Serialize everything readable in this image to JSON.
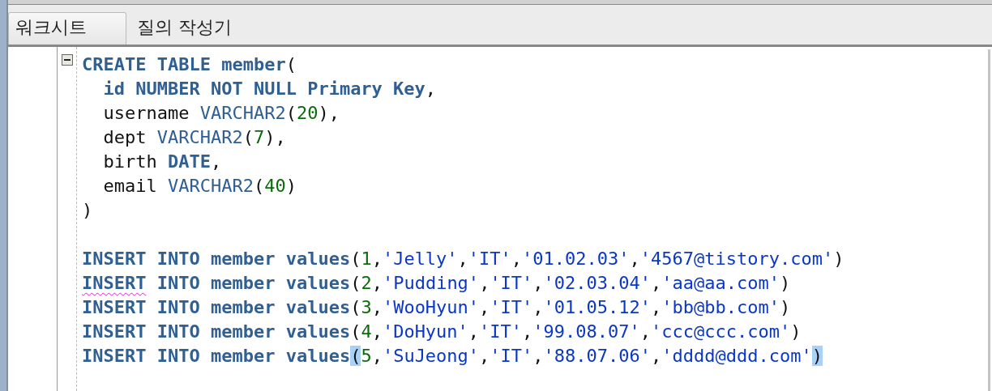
{
  "tabs": [
    {
      "label": "워크시트",
      "selected": true
    },
    {
      "label": "질의 작성기",
      "selected": false
    }
  ],
  "editor": {
    "lines": [
      {
        "kind": "code",
        "expanded": true,
        "tokens": [
          {
            "kind": "keyword",
            "text": "CREATE TABLE member"
          },
          {
            "kind": "plain",
            "text": "("
          }
        ]
      },
      {
        "kind": "code",
        "tokens": [
          {
            "kind": "keyword",
            "text": "  id NUMBER NOT NULL Primary Key"
          },
          {
            "kind": "plain",
            "text": ","
          }
        ]
      },
      {
        "kind": "code",
        "tokens": [
          {
            "kind": "plain",
            "text": "  username "
          },
          {
            "kind": "type",
            "text": "VARCHAR2"
          },
          {
            "kind": "plain",
            "text": "("
          },
          {
            "kind": "number",
            "text": "20"
          },
          {
            "kind": "plain",
            "text": "),"
          }
        ]
      },
      {
        "kind": "code",
        "tokens": [
          {
            "kind": "plain",
            "text": "  dept "
          },
          {
            "kind": "type",
            "text": "VARCHAR2"
          },
          {
            "kind": "plain",
            "text": "("
          },
          {
            "kind": "number",
            "text": "7"
          },
          {
            "kind": "plain",
            "text": "),"
          }
        ]
      },
      {
        "kind": "code",
        "tokens": [
          {
            "kind": "plain",
            "text": "  birth "
          },
          {
            "kind": "keyword",
            "text": "DATE"
          },
          {
            "kind": "plain",
            "text": ","
          }
        ]
      },
      {
        "kind": "code",
        "tokens": [
          {
            "kind": "plain",
            "text": "  email "
          },
          {
            "kind": "type",
            "text": "VARCHAR2"
          },
          {
            "kind": "plain",
            "text": "("
          },
          {
            "kind": "number",
            "text": "40"
          },
          {
            "kind": "plain",
            "text": ")"
          }
        ]
      },
      {
        "kind": "code",
        "tokens": [
          {
            "kind": "plain",
            "text": ")"
          }
        ]
      },
      {
        "kind": "blank"
      },
      {
        "kind": "code",
        "tokens": [
          {
            "kind": "keyword",
            "text": "INSERT INTO member values"
          },
          {
            "kind": "plain",
            "text": "("
          },
          {
            "kind": "number",
            "text": "1"
          },
          {
            "kind": "plain",
            "text": ","
          },
          {
            "kind": "string",
            "text": "'Jelly'"
          },
          {
            "kind": "plain",
            "text": ","
          },
          {
            "kind": "string",
            "text": "'IT'"
          },
          {
            "kind": "plain",
            "text": ","
          },
          {
            "kind": "string",
            "text": "'01.02.03'"
          },
          {
            "kind": "plain",
            "text": ","
          },
          {
            "kind": "string",
            "text": "'4567@tistory.com'"
          },
          {
            "kind": "plain",
            "text": ")"
          }
        ]
      },
      {
        "kind": "code",
        "tokens": [
          {
            "kind": "keyword",
            "text": "INSERT",
            "misspelled": true
          },
          {
            "kind": "keyword",
            "text": " INTO member values"
          },
          {
            "kind": "plain",
            "text": "("
          },
          {
            "kind": "number",
            "text": "2"
          },
          {
            "kind": "plain",
            "text": ","
          },
          {
            "kind": "string",
            "text": "'Pudding'"
          },
          {
            "kind": "plain",
            "text": ","
          },
          {
            "kind": "string",
            "text": "'IT'"
          },
          {
            "kind": "plain",
            "text": ","
          },
          {
            "kind": "string",
            "text": "'02.03.04'"
          },
          {
            "kind": "plain",
            "text": ","
          },
          {
            "kind": "string",
            "text": "'aa@aa.com'"
          },
          {
            "kind": "plain",
            "text": ")"
          }
        ]
      },
      {
        "kind": "code",
        "tokens": [
          {
            "kind": "keyword",
            "text": "INSERT INTO member values"
          },
          {
            "kind": "plain",
            "text": "("
          },
          {
            "kind": "number",
            "text": "3"
          },
          {
            "kind": "plain",
            "text": ","
          },
          {
            "kind": "string",
            "text": "'WooHyun'"
          },
          {
            "kind": "plain",
            "text": ","
          },
          {
            "kind": "string",
            "text": "'IT'"
          },
          {
            "kind": "plain",
            "text": ","
          },
          {
            "kind": "string",
            "text": "'01.05.12'"
          },
          {
            "kind": "plain",
            "text": ","
          },
          {
            "kind": "string",
            "text": "'bb@bb.com'"
          },
          {
            "kind": "plain",
            "text": ")"
          }
        ]
      },
      {
        "kind": "code",
        "tokens": [
          {
            "kind": "keyword",
            "text": "INSERT INTO member values"
          },
          {
            "kind": "plain",
            "text": "("
          },
          {
            "kind": "number",
            "text": "4"
          },
          {
            "kind": "plain",
            "text": ","
          },
          {
            "kind": "string",
            "text": "'DoHyun'"
          },
          {
            "kind": "plain",
            "text": ","
          },
          {
            "kind": "string",
            "text": "'IT'"
          },
          {
            "kind": "plain",
            "text": ","
          },
          {
            "kind": "string",
            "text": "'99.08.07'"
          },
          {
            "kind": "plain",
            "text": ","
          },
          {
            "kind": "string",
            "text": "'ccc@ccc.com'"
          },
          {
            "kind": "plain",
            "text": ")"
          }
        ]
      },
      {
        "kind": "code",
        "tokens": [
          {
            "kind": "keyword",
            "text": "INSERT INTO member values"
          },
          {
            "kind": "plain",
            "text": "(",
            "highlighted": true
          },
          {
            "kind": "number",
            "text": "5"
          },
          {
            "kind": "plain",
            "text": ","
          },
          {
            "kind": "string",
            "text": "'SuJeong'"
          },
          {
            "kind": "plain",
            "text": ","
          },
          {
            "kind": "string",
            "text": "'IT'"
          },
          {
            "kind": "plain",
            "text": ","
          },
          {
            "kind": "string",
            "text": "'88.07.06'"
          },
          {
            "kind": "plain",
            "text": ","
          },
          {
            "kind": "string",
            "text": "'dddd@ddd.com'"
          },
          {
            "kind": "plain",
            "text": ")",
            "highlighted": true
          }
        ]
      }
    ]
  }
}
